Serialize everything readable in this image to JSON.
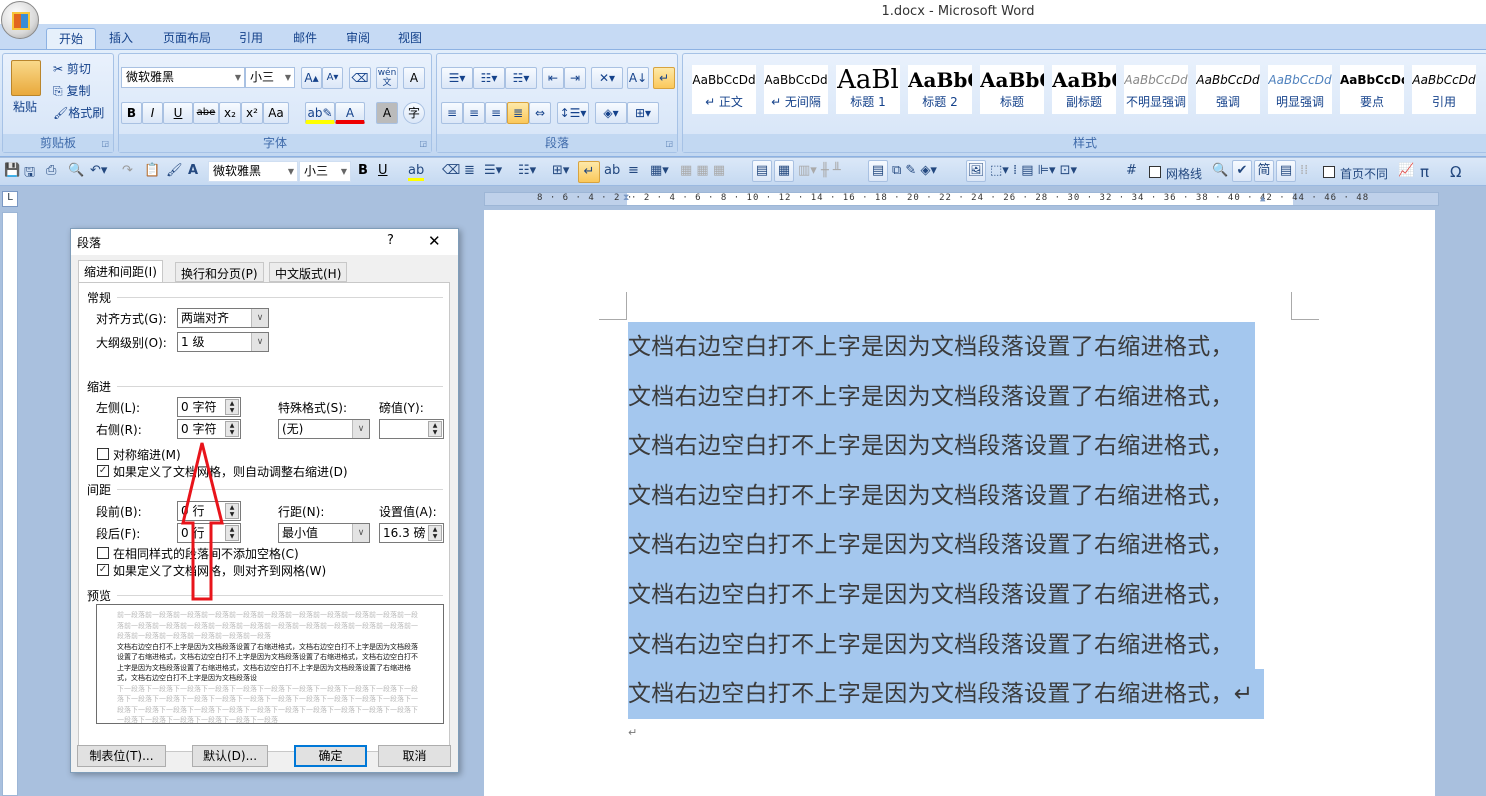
{
  "window": {
    "title": "1.docx - Microsoft Word"
  },
  "tabs": [
    "开始",
    "插入",
    "页面布局",
    "引用",
    "邮件",
    "审阅",
    "视图"
  ],
  "ribbon": {
    "clipboard": {
      "label": "剪贴板",
      "paste": "粘贴",
      "cut": "剪切",
      "copy": "复制",
      "format_painter": "格式刷"
    },
    "font": {
      "label": "字体",
      "font_name": "微软雅黑",
      "font_size": "小三",
      "bold": "B",
      "italic": "I",
      "underline": "U",
      "strike": "abe",
      "subscript": "x₂",
      "superscript": "x²",
      "change_case": "Aa",
      "grow": "A▴",
      "shrink": "A▾",
      "phonetic": "wén 文",
      "char_border": "A",
      "char_shading": "A",
      "enclose": "字"
    },
    "paragraph": {
      "label": "段落"
    },
    "styles": {
      "label": "样式",
      "items": [
        {
          "preview": "AaBbCcDd",
          "name": "↵ 正文"
        },
        {
          "preview": "AaBbCcDd",
          "name": "↵ 无间隔"
        },
        {
          "preview": "AaBl",
          "name": "标题 1"
        },
        {
          "preview": "AaBbC",
          "name": "标题 2"
        },
        {
          "preview": "AaBbC",
          "name": "标题"
        },
        {
          "preview": "AaBbC",
          "name": "副标题"
        },
        {
          "preview": "AaBbCcDd",
          "name": "不明显强调"
        },
        {
          "preview": "AaBbCcDd",
          "name": "强调"
        },
        {
          "preview": "AaBbCcDd",
          "name": "明显强调"
        },
        {
          "preview": "AaBbCcDd",
          "name": "要点"
        },
        {
          "preview": "AaBbCcDd",
          "name": "引用"
        }
      ]
    }
  },
  "qat": {
    "font_name": "微软雅黑",
    "font_size": "小三",
    "gridlines": "网格线",
    "first_page_diff": "首页不同",
    "bold": "B",
    "underline": "U",
    "pi": "π",
    "omega": "Ω"
  },
  "ruler": {
    "left_ticks": "8 · 6 · 4 · 2 ·",
    "right_ticks": "· 2 · 4 · 6 · 8 · 10 · 12 · 14 · 16 · 18 · 20 · 22 · 24 · 26 · 28 · 30 · 32 · 34 · 36 · 38 · 40 · 42 · 44 · 46 · 48",
    "tab_selector": "L"
  },
  "document": {
    "lines": [
      "文档右边空白打不上字是因为文档段落设置了右缩进格式，",
      "文档右边空白打不上字是因为文档段落设置了右缩进格式，",
      "文档右边空白打不上字是因为文档段落设置了右缩进格式，",
      "文档右边空白打不上字是因为文档段落设置了右缩进格式，",
      "文档右边空白打不上字是因为文档段落设置了右缩进格式，",
      "文档右边空白打不上字是因为文档段落设置了右缩进格式，",
      "文档右边空白打不上字是因为文档段落设置了右缩进格式，",
      "文档右边空白打不上字是因为文档段落设置了右缩进格式，↵"
    ],
    "empty_para": "↵"
  },
  "dialog": {
    "title": "段落",
    "help": "?",
    "close": "✕",
    "tabs": [
      "缩进和间距(I)",
      "换行和分页(P)",
      "中文版式(H)"
    ],
    "general": {
      "heading": "常规",
      "alignment_label": "对齐方式(G):",
      "alignment_value": "两端对齐",
      "outline_label": "大纲级别(O):",
      "outline_value": "1 级"
    },
    "indent": {
      "heading": "缩进",
      "left_label": "左侧(L):",
      "left_value": "0 字符",
      "right_label": "右侧(R):",
      "right_value": "0 字符",
      "special_label": "特殊格式(S):",
      "special_value": "(无)",
      "by_label": "磅值(Y):",
      "by_value": "",
      "mirror_label": "对称缩进(M)",
      "mirror_checked": false,
      "auto_adjust_label": "如果定义了文档网格，则自动调整右缩进(D)",
      "auto_adjust_checked": true
    },
    "spacing": {
      "heading": "间距",
      "before_label": "段前(B):",
      "before_value": "0 行",
      "after_label": "段后(F):",
      "after_value": "0 行",
      "line_label": "行距(N):",
      "line_value": "最小值",
      "at_label": "设置值(A):",
      "at_value": "16.3 磅",
      "no_space_label": "在相同样式的段落间不添加空格(C)",
      "no_space_checked": false,
      "snap_label": "如果定义了文档网格，则对齐到网格(W)",
      "snap_checked": true
    },
    "preview": {
      "heading": "预览",
      "prev_text": "前一段落前一段落前一段落前一段落前一段落前一段落前一段落前一段落前一段落前一段落前一段落前一段落前一段落前一段落前一段落前一段落前一段落前一段落前一段落前一段落前一段落前一段落前一段落前一段落前一段落前一段落前一段落",
      "body_text": "文档右边空白打不上字是因为文档段落设置了右缩进格式，文档右边空白打不上字是因为文档段落设置了右缩进格式，文档右边空白打不上字是因为文档段落设置了右缩进格式，文档右边空白打不上字是因为文档段落设置了右缩进格式，文档右边空白打不上字是因为文档段落设置了右缩进格式，文档右边空白打不上字是因为文档段落设",
      "next_text": "下一段落下一段落下一段落下一段落下一段落下一段落下一段落下一段落下一段落下一段落下一段落下一段落下一段落下一段落下一段落下一段落下一段落下一段落下一段落下一段落下一段落下一段落下一段落下一段落下一段落下一段落下一段落下一段落下一段落下一段落下一段落下一段落下一段落下一段落下一段落下一段落下一段落下一段落"
    },
    "buttons": {
      "tabs": "制表位(T)...",
      "default": "默认(D)...",
      "ok": "确定",
      "cancel": "取消"
    }
  },
  "colors": {
    "selection": "#a4c7ee",
    "annotation_arrow": "#e8141b",
    "ribbon": "#d5e4f7"
  }
}
